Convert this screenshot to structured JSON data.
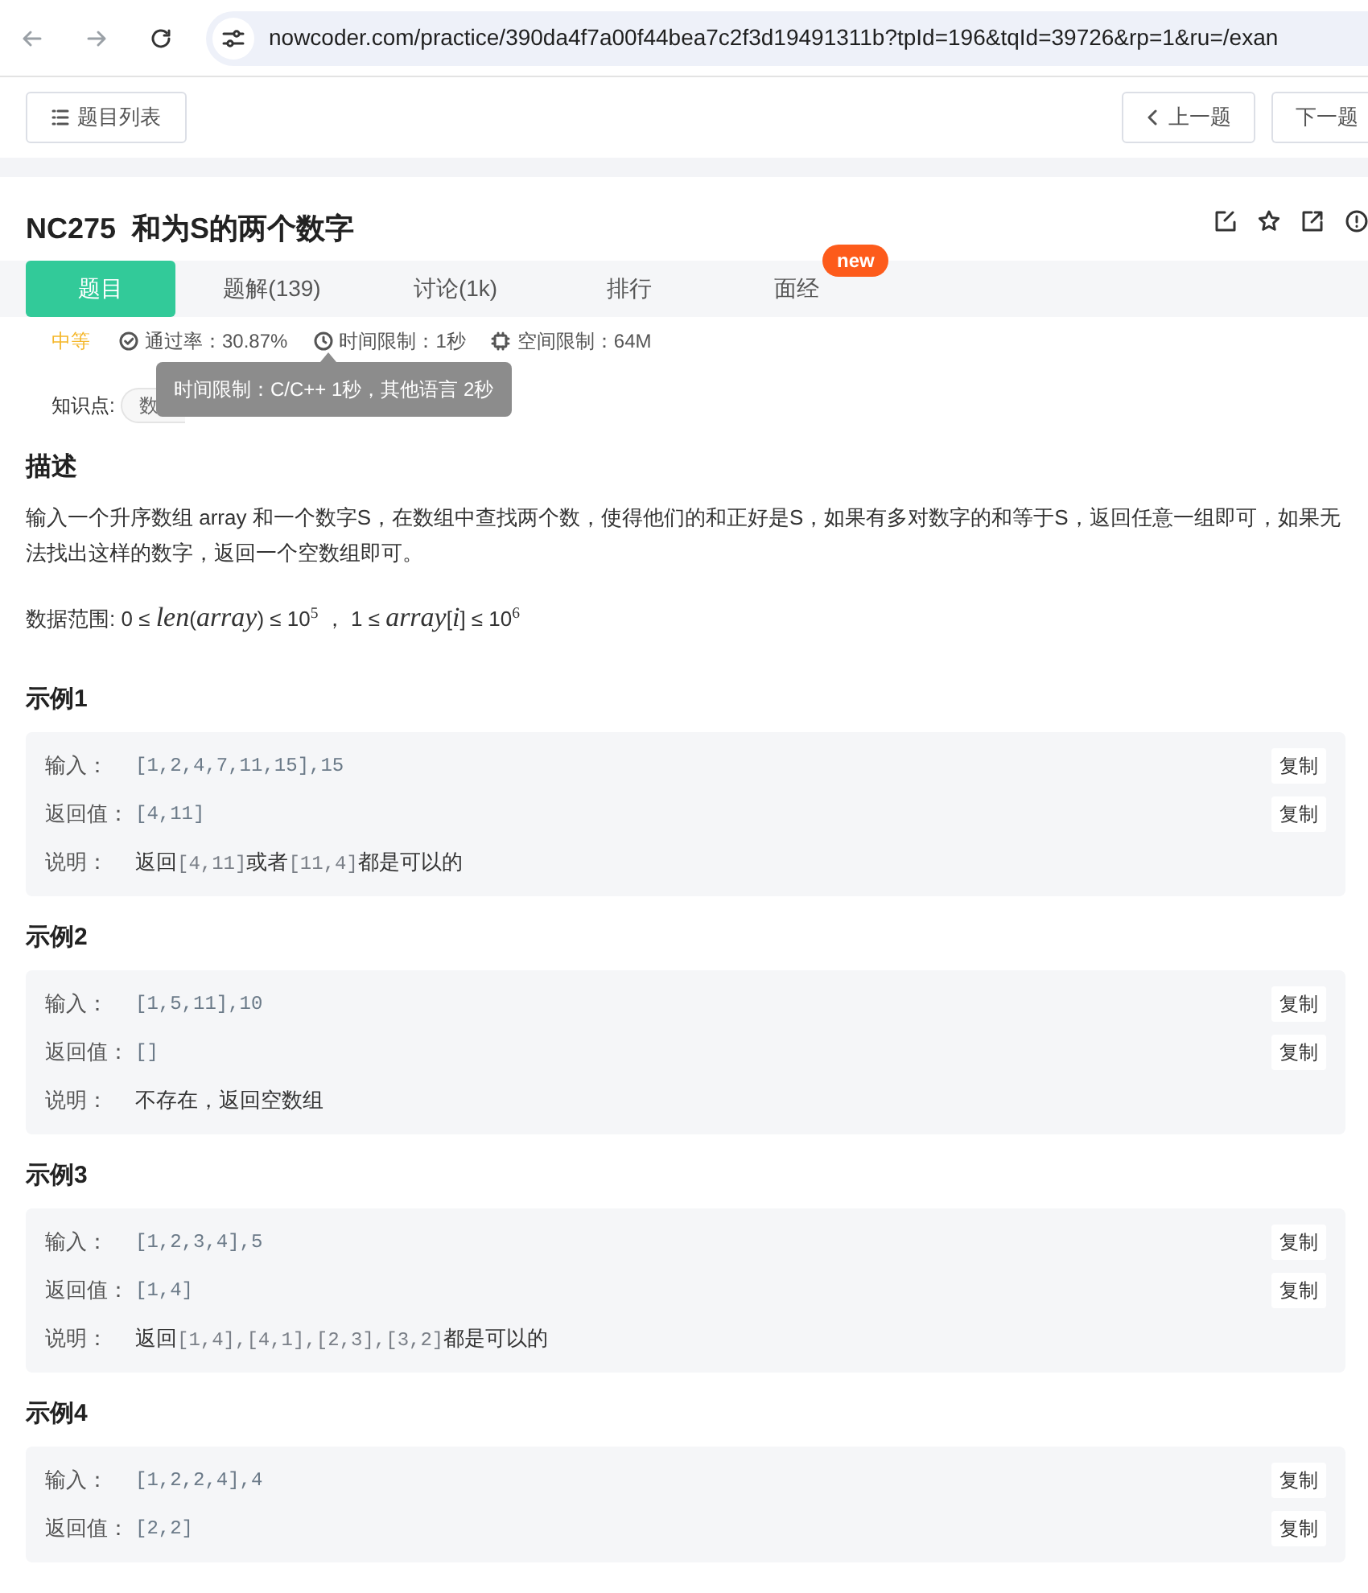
{
  "browser": {
    "url": "nowcoder.com/practice/390da4f7a00f44bea7c2f3d19491311b?tpId=196&tqId=39726&rp=1&ru=/exan"
  },
  "toolbar": {
    "list_button": "题目列表",
    "prev_button": "上一题",
    "next_button": "下一题"
  },
  "problem": {
    "title": "NC275  和为S的两个数字"
  },
  "tabs": [
    {
      "label": "题目",
      "selected": true
    },
    {
      "label": "题解(139)",
      "selected": false
    },
    {
      "label": "讨论(1k)",
      "selected": false
    },
    {
      "label": "排行",
      "selected": false
    },
    {
      "label": "面经",
      "selected": false,
      "badge": "new"
    }
  ],
  "meta": {
    "difficulty": "中等",
    "pass_rate": "通过率：30.87%",
    "time_limit": "时间限制：1秒",
    "memory_limit": "空间限制：64M"
  },
  "tooltip": "时间限制：C/C++ 1秒，其他语言 2秒",
  "knowledge": {
    "label": "知识点:",
    "tags": [
      "数"
    ]
  },
  "description": {
    "heading": "描述",
    "text": "输入一个升序数组 array 和一个数字S，在数组中查找两个数，使得他们的和正好是S，如果有多对数字的和等于S，返回任意一组即可，如果无法找出这样的数字，返回一个空数组即可。",
    "range": "数据范围: 0 ≤ *len*(*array*) ≤ 10$^{5}$ ，  1 ≤ *array*[*i*] ≤ 10$^{6}$"
  },
  "examples": [
    {
      "heading": "示例1",
      "rows": [
        {
          "label": "输入：",
          "value": "[1,2,4,7,11,15],15",
          "copy": "复制"
        },
        {
          "label": "返回值：",
          "value": "[4,11]",
          "copy": "复制"
        },
        {
          "label": "说明：",
          "parts": [
            {
              "kind": "text",
              "text": "返回"
            },
            {
              "kind": "code",
              "text": "[4,11]"
            },
            {
              "kind": "text",
              "text": "或者"
            },
            {
              "kind": "code",
              "text": "[11,4]"
            },
            {
              "kind": "text",
              "text": "都是可以的"
            }
          ]
        }
      ]
    },
    {
      "heading": "示例2",
      "rows": [
        {
          "label": "输入：",
          "value": "[1,5,11],10",
          "copy": "复制"
        },
        {
          "label": "返回值：",
          "value": "[]",
          "copy": "复制"
        },
        {
          "label": "说明：",
          "parts": [
            {
              "kind": "text",
              "text": "不存在，返回空数组"
            }
          ]
        }
      ]
    },
    {
      "heading": "示例3",
      "rows": [
        {
          "label": "输入：",
          "value": "[1,2,3,4],5",
          "copy": "复制"
        },
        {
          "label": "返回值：",
          "value": "[1,4]",
          "copy": "复制"
        },
        {
          "label": "说明：",
          "parts": [
            {
              "kind": "text",
              "text": "返回"
            },
            {
              "kind": "code",
              "text": "[1,4],[4,1],[2,3],[3,2]"
            },
            {
              "kind": "text",
              "text": "都是可以的"
            }
          ]
        }
      ]
    },
    {
      "heading": "示例4",
      "rows": [
        {
          "label": "输入：",
          "value": "[1,2,2,4],4",
          "copy": "复制"
        },
        {
          "label": "返回值：",
          "value": "[2,2]",
          "copy": "复制"
        }
      ]
    }
  ]
}
